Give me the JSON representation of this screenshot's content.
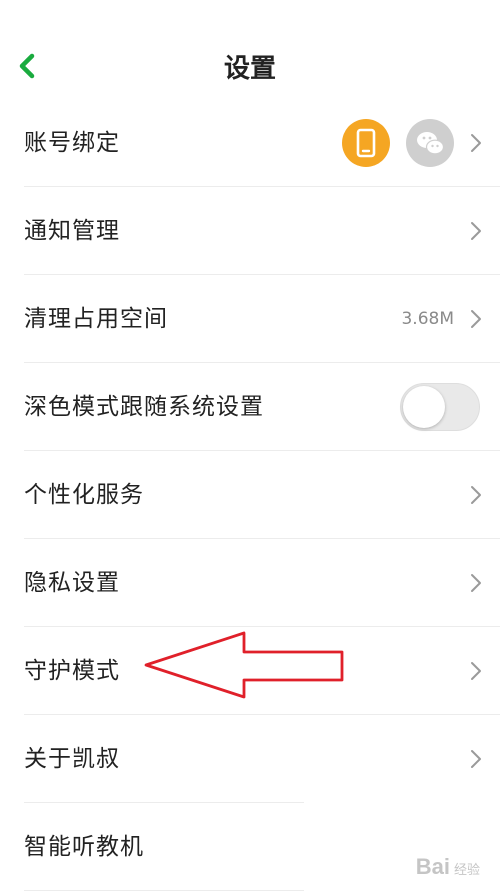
{
  "header": {
    "title": "设置"
  },
  "settings": {
    "account_binding": {
      "label": "账号绑定"
    },
    "notification": {
      "label": "通知管理"
    },
    "clear_storage": {
      "label": "清理占用空间",
      "value": "3.68M"
    },
    "dark_mode": {
      "label": "深色模式跟随系统设置",
      "enabled": false
    },
    "personalized": {
      "label": "个性化服务"
    },
    "privacy": {
      "label": "隐私设置"
    },
    "guardian_mode": {
      "label": "守护模式"
    },
    "about": {
      "label": "关于凯叔"
    },
    "smart_player": {
      "label": "智能听教机"
    }
  },
  "icons": {
    "back": "chevron-left-icon",
    "phone": "phone-icon",
    "wechat": "wechat-icon",
    "chevron": "chevron-right-icon"
  },
  "colors": {
    "accent_green": "#1aab3f",
    "phone_badge": "#f5a623",
    "wechat_badge": "#cfcfcf",
    "annotation_arrow": "#e0202a"
  },
  "watermark": {
    "text": "Bai",
    "sub": "经验"
  }
}
